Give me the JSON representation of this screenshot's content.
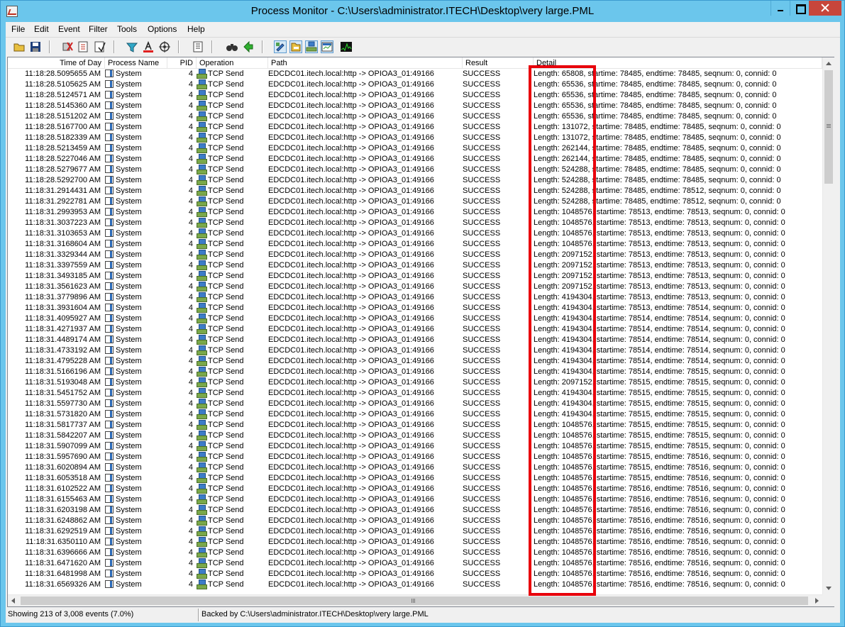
{
  "window": {
    "title": "Process Monitor - C:\\Users\\administrator.ITECH\\Desktop\\very large.PML"
  },
  "menu": [
    "File",
    "Edit",
    "Event",
    "Filter",
    "Tools",
    "Options",
    "Help"
  ],
  "toolbar": {
    "icons": [
      "open-icon",
      "save-icon",
      "capture-icon",
      "autoscroll-icon",
      "clear-icon",
      "filter-icon",
      "highlight-icon",
      "target-icon",
      "process-tree-icon",
      "find-icon",
      "jump-icon",
      "registry-activity-icon",
      "file-activity-icon",
      "network-activity-icon",
      "process-activity-icon",
      "profiling-icon"
    ],
    "pressed": [
      "registry-activity-icon",
      "file-activity-icon",
      "network-activity-icon",
      "process-activity-icon"
    ]
  },
  "columns": {
    "time": "Time of Day",
    "process": "Process Name",
    "pid": "PID",
    "operation": "Operation",
    "path": "Path",
    "result": "Result",
    "detail": "Detail"
  },
  "rows": [
    {
      "time": "11:18:28.5095655 AM",
      "process": "System",
      "pid": "4",
      "operation": "TCP Send",
      "path": "EDCDC01.itech.local:http -> OPIOA3_01:49166",
      "result": "SUCCESS",
      "detail": "Length: 65808, startime: 78485, endtime: 78485, seqnum: 0, connid: 0"
    },
    {
      "time": "11:18:28.5105625 AM",
      "process": "System",
      "pid": "4",
      "operation": "TCP Send",
      "path": "EDCDC01.itech.local:http -> OPIOA3_01:49166",
      "result": "SUCCESS",
      "detail": "Length: 65536, startime: 78485, endtime: 78485, seqnum: 0, connid: 0"
    },
    {
      "time": "11:18:28.5124571 AM",
      "process": "System",
      "pid": "4",
      "operation": "TCP Send",
      "path": "EDCDC01.itech.local:http -> OPIOA3_01:49166",
      "result": "SUCCESS",
      "detail": "Length: 65536, startime: 78485, endtime: 78485, seqnum: 0, connid: 0"
    },
    {
      "time": "11:18:28.5145360 AM",
      "process": "System",
      "pid": "4",
      "operation": "TCP Send",
      "path": "EDCDC01.itech.local:http -> OPIOA3_01:49166",
      "result": "SUCCESS",
      "detail": "Length: 65536, startime: 78485, endtime: 78485, seqnum: 0, connid: 0"
    },
    {
      "time": "11:18:28.5151202 AM",
      "process": "System",
      "pid": "4",
      "operation": "TCP Send",
      "path": "EDCDC01.itech.local:http -> OPIOA3_01:49166",
      "result": "SUCCESS",
      "detail": "Length: 65536, startime: 78485, endtime: 78485, seqnum: 0, connid: 0"
    },
    {
      "time": "11:18:28.5167700 AM",
      "process": "System",
      "pid": "4",
      "operation": "TCP Send",
      "path": "EDCDC01.itech.local:http -> OPIOA3_01:49166",
      "result": "SUCCESS",
      "detail": "Length: 131072, startime: 78485, endtime: 78485, seqnum: 0, connid: 0"
    },
    {
      "time": "11:18:28.5182339 AM",
      "process": "System",
      "pid": "4",
      "operation": "TCP Send",
      "path": "EDCDC01.itech.local:http -> OPIOA3_01:49166",
      "result": "SUCCESS",
      "detail": "Length: 131072, startime: 78485, endtime: 78485, seqnum: 0, connid: 0"
    },
    {
      "time": "11:18:28.5213459 AM",
      "process": "System",
      "pid": "4",
      "operation": "TCP Send",
      "path": "EDCDC01.itech.local:http -> OPIOA3_01:49166",
      "result": "SUCCESS",
      "detail": "Length: 262144, startime: 78485, endtime: 78485, seqnum: 0, connid: 0"
    },
    {
      "time": "11:18:28.5227046 AM",
      "process": "System",
      "pid": "4",
      "operation": "TCP Send",
      "path": "EDCDC01.itech.local:http -> OPIOA3_01:49166",
      "result": "SUCCESS",
      "detail": "Length: 262144, startime: 78485, endtime: 78485, seqnum: 0, connid: 0"
    },
    {
      "time": "11:18:28.5279677 AM",
      "process": "System",
      "pid": "4",
      "operation": "TCP Send",
      "path": "EDCDC01.itech.local:http -> OPIOA3_01:49166",
      "result": "SUCCESS",
      "detail": "Length: 524288, startime: 78485, endtime: 78485, seqnum: 0, connid: 0"
    },
    {
      "time": "11:18:28.5292700 AM",
      "process": "System",
      "pid": "4",
      "operation": "TCP Send",
      "path": "EDCDC01.itech.local:http -> OPIOA3_01:49166",
      "result": "SUCCESS",
      "detail": "Length: 524288, startime: 78485, endtime: 78485, seqnum: 0, connid: 0"
    },
    {
      "time": "11:18:31.2914431 AM",
      "process": "System",
      "pid": "4",
      "operation": "TCP Send",
      "path": "EDCDC01.itech.local:http -> OPIOA3_01:49166",
      "result": "SUCCESS",
      "detail": "Length: 524288, startime: 78485, endtime: 78512, seqnum: 0, connid: 0"
    },
    {
      "time": "11:18:31.2922781 AM",
      "process": "System",
      "pid": "4",
      "operation": "TCP Send",
      "path": "EDCDC01.itech.local:http -> OPIOA3_01:49166",
      "result": "SUCCESS",
      "detail": "Length: 524288, startime: 78485, endtime: 78512, seqnum: 0, connid: 0"
    },
    {
      "time": "11:18:31.2993953 AM",
      "process": "System",
      "pid": "4",
      "operation": "TCP Send",
      "path": "EDCDC01.itech.local:http -> OPIOA3_01:49166",
      "result": "SUCCESS",
      "detail": "Length: 1048576, startime: 78513, endtime: 78513, seqnum: 0, connid: 0"
    },
    {
      "time": "11:18:31.3037223 AM",
      "process": "System",
      "pid": "4",
      "operation": "TCP Send",
      "path": "EDCDC01.itech.local:http -> OPIOA3_01:49166",
      "result": "SUCCESS",
      "detail": "Length: 1048576, startime: 78513, endtime: 78513, seqnum: 0, connid: 0"
    },
    {
      "time": "11:18:31.3103653 AM",
      "process": "System",
      "pid": "4",
      "operation": "TCP Send",
      "path": "EDCDC01.itech.local:http -> OPIOA3_01:49166",
      "result": "SUCCESS",
      "detail": "Length: 1048576, startime: 78513, endtime: 78513, seqnum: 0, connid: 0"
    },
    {
      "time": "11:18:31.3168604 AM",
      "process": "System",
      "pid": "4",
      "operation": "TCP Send",
      "path": "EDCDC01.itech.local:http -> OPIOA3_01:49166",
      "result": "SUCCESS",
      "detail": "Length: 1048576, startime: 78513, endtime: 78513, seqnum: 0, connid: 0"
    },
    {
      "time": "11:18:31.3329344 AM",
      "process": "System",
      "pid": "4",
      "operation": "TCP Send",
      "path": "EDCDC01.itech.local:http -> OPIOA3_01:49166",
      "result": "SUCCESS",
      "detail": "Length: 2097152, startime: 78513, endtime: 78513, seqnum: 0, connid: 0"
    },
    {
      "time": "11:18:31.3397559 AM",
      "process": "System",
      "pid": "4",
      "operation": "TCP Send",
      "path": "EDCDC01.itech.local:http -> OPIOA3_01:49166",
      "result": "SUCCESS",
      "detail": "Length: 2097152, startime: 78513, endtime: 78513, seqnum: 0, connid: 0"
    },
    {
      "time": "11:18:31.3493185 AM",
      "process": "System",
      "pid": "4",
      "operation": "TCP Send",
      "path": "EDCDC01.itech.local:http -> OPIOA3_01:49166",
      "result": "SUCCESS",
      "detail": "Length: 2097152, startime: 78513, endtime: 78513, seqnum: 0, connid: 0"
    },
    {
      "time": "11:18:31.3561623 AM",
      "process": "System",
      "pid": "4",
      "operation": "TCP Send",
      "path": "EDCDC01.itech.local:http -> OPIOA3_01:49166",
      "result": "SUCCESS",
      "detail": "Length: 2097152, startime: 78513, endtime: 78513, seqnum: 0, connid: 0"
    },
    {
      "time": "11:18:31.3779896 AM",
      "process": "System",
      "pid": "4",
      "operation": "TCP Send",
      "path": "EDCDC01.itech.local:http -> OPIOA3_01:49166",
      "result": "SUCCESS",
      "detail": "Length: 4194304, startime: 78513, endtime: 78513, seqnum: 0, connid: 0"
    },
    {
      "time": "11:18:31.3931604 AM",
      "process": "System",
      "pid": "4",
      "operation": "TCP Send",
      "path": "EDCDC01.itech.local:http -> OPIOA3_01:49166",
      "result": "SUCCESS",
      "detail": "Length: 4194304, startime: 78513, endtime: 78514, seqnum: 0, connid: 0"
    },
    {
      "time": "11:18:31.4095927 AM",
      "process": "System",
      "pid": "4",
      "operation": "TCP Send",
      "path": "EDCDC01.itech.local:http -> OPIOA3_01:49166",
      "result": "SUCCESS",
      "detail": "Length: 4194304, startime: 78514, endtime: 78514, seqnum: 0, connid: 0"
    },
    {
      "time": "11:18:31.4271937 AM",
      "process": "System",
      "pid": "4",
      "operation": "TCP Send",
      "path": "EDCDC01.itech.local:http -> OPIOA3_01:49166",
      "result": "SUCCESS",
      "detail": "Length: 4194304, startime: 78514, endtime: 78514, seqnum: 0, connid: 0"
    },
    {
      "time": "11:18:31.4489174 AM",
      "process": "System",
      "pid": "4",
      "operation": "TCP Send",
      "path": "EDCDC01.itech.local:http -> OPIOA3_01:49166",
      "result": "SUCCESS",
      "detail": "Length: 4194304, startime: 78514, endtime: 78514, seqnum: 0, connid: 0"
    },
    {
      "time": "11:18:31.4733192 AM",
      "process": "System",
      "pid": "4",
      "operation": "TCP Send",
      "path": "EDCDC01.itech.local:http -> OPIOA3_01:49166",
      "result": "SUCCESS",
      "detail": "Length: 4194304, startime: 78514, endtime: 78514, seqnum: 0, connid: 0"
    },
    {
      "time": "11:18:31.4795228 AM",
      "process": "System",
      "pid": "4",
      "operation": "TCP Send",
      "path": "EDCDC01.itech.local:http -> OPIOA3_01:49166",
      "result": "SUCCESS",
      "detail": "Length: 4194304, startime: 78514, endtime: 78514, seqnum: 0, connid: 0"
    },
    {
      "time": "11:18:31.5166196 AM",
      "process": "System",
      "pid": "4",
      "operation": "TCP Send",
      "path": "EDCDC01.itech.local:http -> OPIOA3_01:49166",
      "result": "SUCCESS",
      "detail": "Length: 4194304, startime: 78514, endtime: 78515, seqnum: 0, connid: 0"
    },
    {
      "time": "11:18:31.5193048 AM",
      "process": "System",
      "pid": "4",
      "operation": "TCP Send",
      "path": "EDCDC01.itech.local:http -> OPIOA3_01:49166",
      "result": "SUCCESS",
      "detail": "Length: 2097152, startime: 78515, endtime: 78515, seqnum: 0, connid: 0"
    },
    {
      "time": "11:18:31.5451752 AM",
      "process": "System",
      "pid": "4",
      "operation": "TCP Send",
      "path": "EDCDC01.itech.local:http -> OPIOA3_01:49166",
      "result": "SUCCESS",
      "detail": "Length: 4194304, startime: 78515, endtime: 78515, seqnum: 0, connid: 0"
    },
    {
      "time": "11:18:31.5597730 AM",
      "process": "System",
      "pid": "4",
      "operation": "TCP Send",
      "path": "EDCDC01.itech.local:http -> OPIOA3_01:49166",
      "result": "SUCCESS",
      "detail": "Length: 4194304, startime: 78515, endtime: 78515, seqnum: 0, connid: 0"
    },
    {
      "time": "11:18:31.5731820 AM",
      "process": "System",
      "pid": "4",
      "operation": "TCP Send",
      "path": "EDCDC01.itech.local:http -> OPIOA3_01:49166",
      "result": "SUCCESS",
      "detail": "Length: 4194304, startime: 78515, endtime: 78515, seqnum: 0, connid: 0"
    },
    {
      "time": "11:18:31.5817737 AM",
      "process": "System",
      "pid": "4",
      "operation": "TCP Send",
      "path": "EDCDC01.itech.local:http -> OPIOA3_01:49166",
      "result": "SUCCESS",
      "detail": "Length: 1048576, startime: 78515, endtime: 78515, seqnum: 0, connid: 0"
    },
    {
      "time": "11:18:31.5842207 AM",
      "process": "System",
      "pid": "4",
      "operation": "TCP Send",
      "path": "EDCDC01.itech.local:http -> OPIOA3_01:49166",
      "result": "SUCCESS",
      "detail": "Length: 1048576, startime: 78515, endtime: 78515, seqnum: 0, connid: 0"
    },
    {
      "time": "11:18:31.5907099 AM",
      "process": "System",
      "pid": "4",
      "operation": "TCP Send",
      "path": "EDCDC01.itech.local:http -> OPIOA3_01:49166",
      "result": "SUCCESS",
      "detail": "Length: 1048576, startime: 78515, endtime: 78515, seqnum: 0, connid: 0"
    },
    {
      "time": "11:18:31.5957690 AM",
      "process": "System",
      "pid": "4",
      "operation": "TCP Send",
      "path": "EDCDC01.itech.local:http -> OPIOA3_01:49166",
      "result": "SUCCESS",
      "detail": "Length: 1048576, startime: 78515, endtime: 78516, seqnum: 0, connid: 0"
    },
    {
      "time": "11:18:31.6020894 AM",
      "process": "System",
      "pid": "4",
      "operation": "TCP Send",
      "path": "EDCDC01.itech.local:http -> OPIOA3_01:49166",
      "result": "SUCCESS",
      "detail": "Length: 1048576, startime: 78515, endtime: 78516, seqnum: 0, connid: 0"
    },
    {
      "time": "11:18:31.6053518 AM",
      "process": "System",
      "pid": "4",
      "operation": "TCP Send",
      "path": "EDCDC01.itech.local:http -> OPIOA3_01:49166",
      "result": "SUCCESS",
      "detail": "Length: 1048576, startime: 78515, endtime: 78516, seqnum: 0, connid: 0"
    },
    {
      "time": "11:18:31.6102522 AM",
      "process": "System",
      "pid": "4",
      "operation": "TCP Send",
      "path": "EDCDC01.itech.local:http -> OPIOA3_01:49166",
      "result": "SUCCESS",
      "detail": "Length: 1048576, startime: 78516, endtime: 78516, seqnum: 0, connid: 0"
    },
    {
      "time": "11:18:31.6155463 AM",
      "process": "System",
      "pid": "4",
      "operation": "TCP Send",
      "path": "EDCDC01.itech.local:http -> OPIOA3_01:49166",
      "result": "SUCCESS",
      "detail": "Length: 1048576, startime: 78516, endtime: 78516, seqnum: 0, connid: 0"
    },
    {
      "time": "11:18:31.6203198 AM",
      "process": "System",
      "pid": "4",
      "operation": "TCP Send",
      "path": "EDCDC01.itech.local:http -> OPIOA3_01:49166",
      "result": "SUCCESS",
      "detail": "Length: 1048576, startime: 78516, endtime: 78516, seqnum: 0, connid: 0"
    },
    {
      "time": "11:18:31.6248862 AM",
      "process": "System",
      "pid": "4",
      "operation": "TCP Send",
      "path": "EDCDC01.itech.local:http -> OPIOA3_01:49166",
      "result": "SUCCESS",
      "detail": "Length: 1048576, startime: 78516, endtime: 78516, seqnum: 0, connid: 0"
    },
    {
      "time": "11:18:31.6292519 AM",
      "process": "System",
      "pid": "4",
      "operation": "TCP Send",
      "path": "EDCDC01.itech.local:http -> OPIOA3_01:49166",
      "result": "SUCCESS",
      "detail": "Length: 1048576, startime: 78516, endtime: 78516, seqnum: 0, connid: 0"
    },
    {
      "time": "11:18:31.6350110 AM",
      "process": "System",
      "pid": "4",
      "operation": "TCP Send",
      "path": "EDCDC01.itech.local:http -> OPIOA3_01:49166",
      "result": "SUCCESS",
      "detail": "Length: 1048576, startime: 78516, endtime: 78516, seqnum: 0, connid: 0"
    },
    {
      "time": "11:18:31.6396666 AM",
      "process": "System",
      "pid": "4",
      "operation": "TCP Send",
      "path": "EDCDC01.itech.local:http -> OPIOA3_01:49166",
      "result": "SUCCESS",
      "detail": "Length: 1048576, startime: 78516, endtime: 78516, seqnum: 0, connid: 0"
    },
    {
      "time": "11:18:31.6471620 AM",
      "process": "System",
      "pid": "4",
      "operation": "TCP Send",
      "path": "EDCDC01.itech.local:http -> OPIOA3_01:49166",
      "result": "SUCCESS",
      "detail": "Length: 1048576, startime: 78516, endtime: 78516, seqnum: 0, connid: 0"
    },
    {
      "time": "11:18:31.6481998 AM",
      "process": "System",
      "pid": "4",
      "operation": "TCP Send",
      "path": "EDCDC01.itech.local:http -> OPIOA3_01:49166",
      "result": "SUCCESS",
      "detail": "Length: 1048576, startime: 78516, endtime: 78516, seqnum: 0, connid: 0"
    },
    {
      "time": "11:18:31.6569326 AM",
      "process": "System",
      "pid": "4",
      "operation": "TCP Send",
      "path": "EDCDC01.itech.local:http -> OPIOA3_01:49166",
      "result": "SUCCESS",
      "detail": "Length: 1048576, startime: 78516, endtime: 78516, seqnum: 0, connid: 0"
    }
  ],
  "highlight_color": "#e8000b",
  "status": {
    "events": "Showing 213 of 3,008 events (7.0%)",
    "backing": "Backed by C:\\Users\\administrator.ITECH\\Desktop\\very large.PML"
  }
}
